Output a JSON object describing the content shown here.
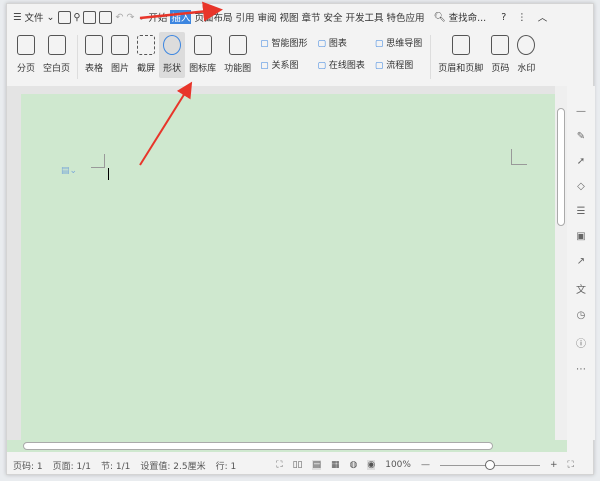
{
  "tabs": {
    "menu": "文件",
    "items": [
      "开始",
      "插入",
      "页面布局",
      "引用",
      "审阅",
      "视图",
      "章节",
      "安全",
      "开发工具",
      "特色应用"
    ],
    "active": "插入",
    "search": "查找命...",
    "help": "?"
  },
  "ribbon": {
    "big": [
      "分页",
      "空白页",
      "表格",
      "图片",
      "截屏",
      "形状",
      "图标库",
      "功能图"
    ],
    "small1": [
      "智能图形",
      "关系图"
    ],
    "small2": [
      "图表",
      "在线图表"
    ],
    "small3": [
      "思维导图",
      "流程图"
    ],
    "right": [
      "页眉和页脚",
      "页码",
      "水印"
    ],
    "selected": "形状"
  },
  "status": {
    "page": "页码: 1",
    "pages": "页面: 1/1",
    "section": "节: 1/1",
    "setting": "设置值: 2.5厘米",
    "row": "行: 1",
    "zoom": "100%",
    "zoom_level": 50
  },
  "colors": {
    "accent": "#3d86e0",
    "page": "#cfe8cf",
    "arrow": "#e8352a"
  }
}
